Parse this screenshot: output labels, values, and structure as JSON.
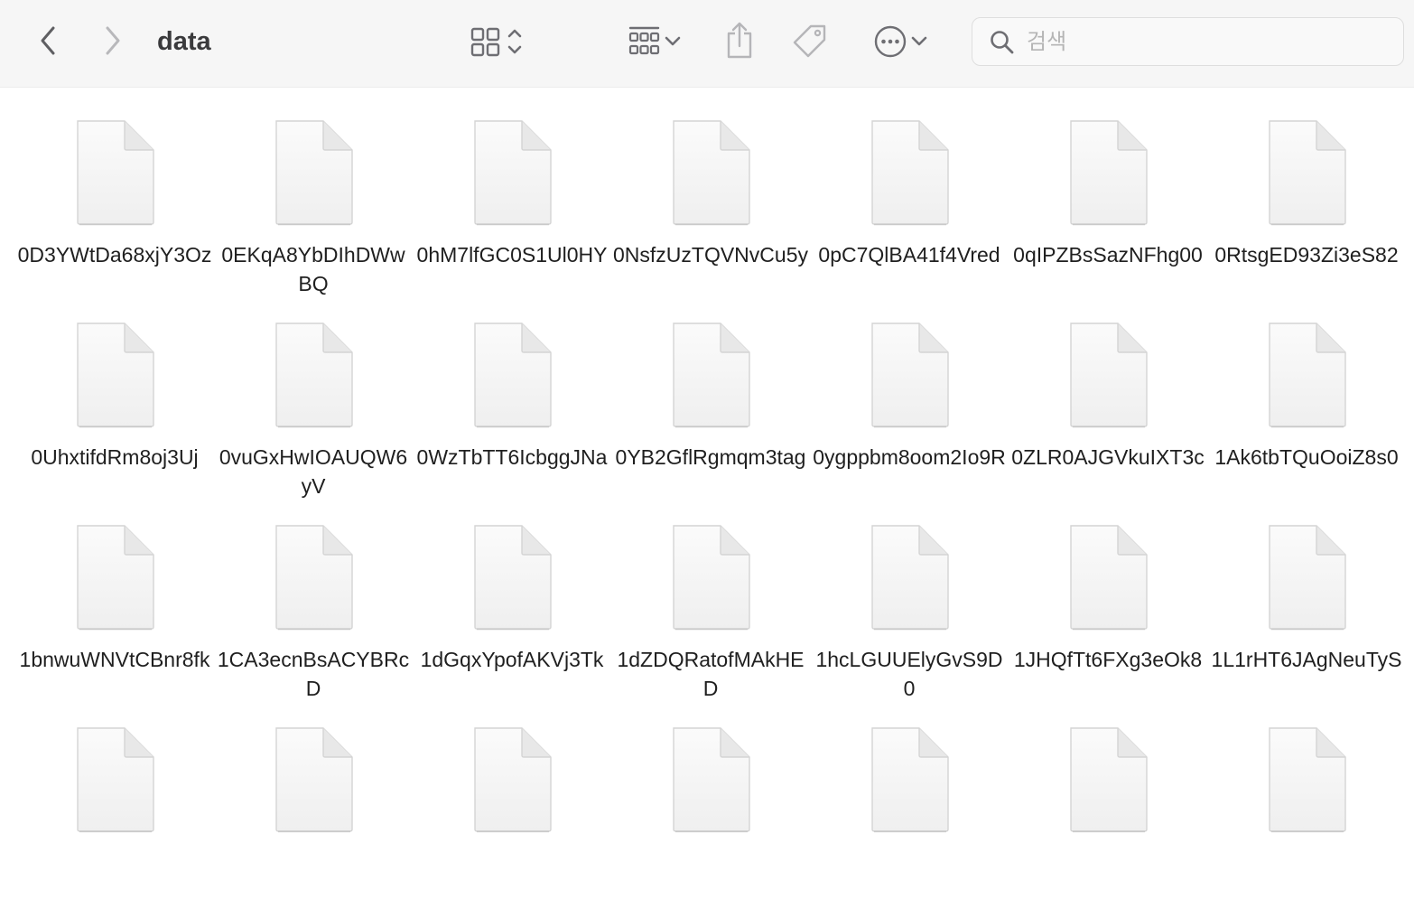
{
  "window": {
    "title": "data"
  },
  "toolbar": {
    "back_icon": "chevron-left-icon",
    "forward_icon": "chevron-right-icon",
    "view_mode_icon": "icon-grid-view-icon",
    "group_icon": "group-by-icon",
    "share_icon": "share-icon",
    "tag_icon": "tag-icon",
    "more_icon": "ellipsis-circle-icon"
  },
  "search": {
    "placeholder": "검색",
    "value": ""
  },
  "colors": {
    "toolbar_bg": "#f6f6f6",
    "icon": "#8e8e93"
  },
  "files": [
    {
      "name": "0D3YWtDa68xjY3Oz"
    },
    {
      "name": "0EKqA8YbDIhDWwBQ"
    },
    {
      "name": "0hM7lfGC0S1Ul0HY"
    },
    {
      "name": "0NsfzUzTQVNvCu5y"
    },
    {
      "name": "0pC7QlBA41f4Vred"
    },
    {
      "name": "0qIPZBsSazNFhg00"
    },
    {
      "name": "0RtsgED93Zi3eS82"
    },
    {
      "name": "0UhxtifdRm8oj3Uj"
    },
    {
      "name": "0vuGxHwIOAUQW6yV"
    },
    {
      "name": "0WzTbTT6IcbggJNa"
    },
    {
      "name": "0YB2GflRgmqm3tag"
    },
    {
      "name": "0ygppbm8oom2Io9R"
    },
    {
      "name": "0ZLR0AJGVkuIXT3c"
    },
    {
      "name": "1Ak6tbTQuOoiZ8s0"
    },
    {
      "name": "1bnwuWNVtCBnr8fk"
    },
    {
      "name": "1CA3ecnBsACYBRcD"
    },
    {
      "name": "1dGqxYpofAKVj3Tk"
    },
    {
      "name": "1dZDQRatofMAkHED"
    },
    {
      "name": "1hcLGUUElyGvS9D0"
    },
    {
      "name": "1JHQfTt6FXg3eOk8"
    },
    {
      "name": "1L1rHT6JAgNeuTyS"
    },
    {
      "name": ""
    },
    {
      "name": ""
    },
    {
      "name": ""
    },
    {
      "name": ""
    },
    {
      "name": ""
    },
    {
      "name": ""
    },
    {
      "name": ""
    }
  ]
}
